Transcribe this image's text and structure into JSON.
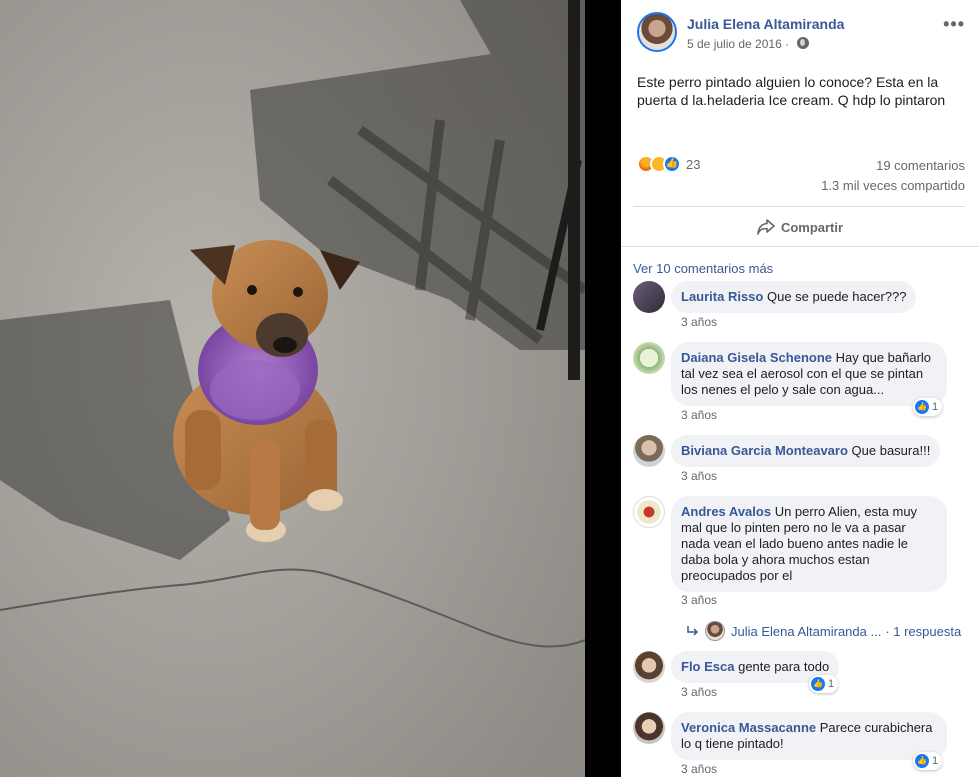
{
  "post": {
    "author": "Julia Elena Altamiranda",
    "date": "5 de julio de 2016 ·",
    "text": "Este perro pintado alguien lo conoce? Esta en la puerta d la.heladeria Ice cream. Q hdp lo pintaron",
    "more_label": "•••",
    "reactions": {
      "count": "23",
      "icons": [
        "angry-icon",
        "sad-icon",
        "like-icon"
      ]
    },
    "comments_count": "19 comentarios",
    "shares_count": "1.3 mil veces compartido",
    "share_label": "Compartir"
  },
  "comments_section": {
    "more_link": "Ver 10 comentarios más",
    "comments": [
      {
        "author": "Laurita Risso",
        "text": "Que se puede hacer???",
        "time": "3 años",
        "likes": ""
      },
      {
        "author": "Daiana Gisela Schenone",
        "text": "Hay que bañarlo tal vez sea el aerosol con el que se pintan los nenes el pelo y sale con agua...",
        "time": "3 años",
        "likes": "1"
      },
      {
        "author": "Biviana Garcia Monteavaro",
        "text": "Que basura!!!",
        "time": "3 años",
        "likes": ""
      },
      {
        "author": "Andres Avalos",
        "text": "Un perro Alien, esta muy mal que lo pinten pero no le va a pasar nada vean el lado bueno antes nadie le daba bola y ahora muchos estan preocupados por el",
        "time": "3 años",
        "likes": ""
      },
      {
        "author": "Flo Esca",
        "text": "gente para todo",
        "time": "3 años",
        "likes": "1"
      },
      {
        "author": "Veronica Massacanne",
        "text": "Parece curabichera lo q tiene pintado!",
        "time": "3 años",
        "likes": "1"
      }
    ],
    "reply": {
      "author": "Julia Elena Altamiranda ...",
      "count": "· 1 respuesta"
    }
  },
  "colors": {
    "link": "#385898",
    "muted": "#65676b",
    "bubble": "#f0f2f5",
    "like_blue": "#1877f2"
  }
}
